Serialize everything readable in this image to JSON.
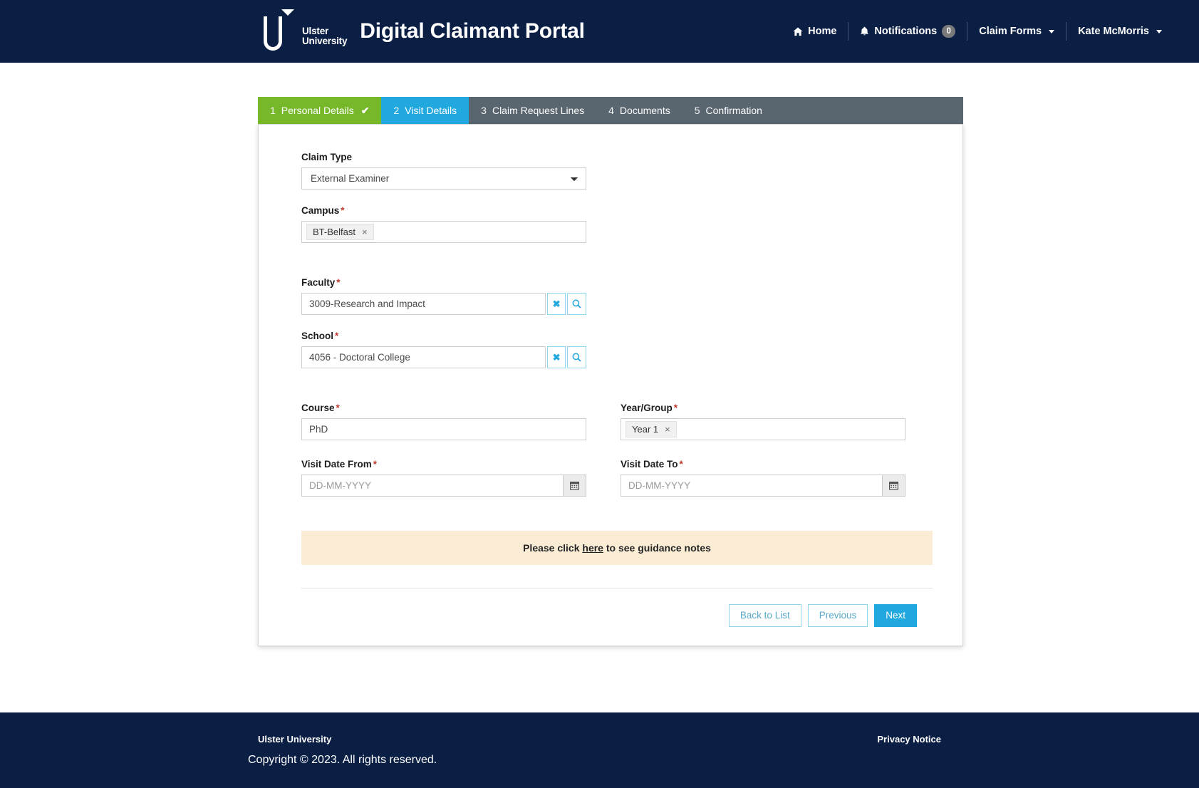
{
  "header": {
    "logo_line1": "Ulster",
    "logo_line2": "University",
    "title": "Digital Claimant Portal",
    "nav": {
      "home": "Home",
      "notifications": "Notifications",
      "notifications_count": "0",
      "claim_forms": "Claim Forms",
      "user": "Kate McMorris"
    }
  },
  "stepper": [
    {
      "num": "1",
      "label": "Personal Details",
      "state": "done",
      "check": "✔"
    },
    {
      "num": "2",
      "label": "Visit Details",
      "state": "active",
      "check": ""
    },
    {
      "num": "3",
      "label": "Claim Request Lines",
      "state": "",
      "check": ""
    },
    {
      "num": "4",
      "label": "Documents",
      "state": "",
      "check": ""
    },
    {
      "num": "5",
      "label": "Confirmation",
      "state": "",
      "check": ""
    }
  ],
  "form": {
    "claim_type": {
      "label": "Claim Type",
      "value": "External Examiner",
      "options": [
        "External Examiner"
      ]
    },
    "campus": {
      "label": "Campus",
      "required": "*",
      "chip": "BT-Belfast",
      "chip_remove": "×"
    },
    "faculty": {
      "label": "Faculty",
      "required": "*",
      "value": "3009-Research and Impact",
      "clear": "✖",
      "search": "🔍"
    },
    "school": {
      "label": "School",
      "required": "*",
      "value": "4056 - Doctoral College",
      "clear": "✖",
      "search": "🔍"
    },
    "course": {
      "label": "Course",
      "required": "*",
      "value": "PhD"
    },
    "year_group": {
      "label": "Year/Group",
      "required": "*",
      "chip": "Year 1",
      "chip_remove": "×"
    },
    "visit_date_from": {
      "label": "Visit Date From",
      "required": "*",
      "value": "",
      "placeholder": "DD-MM-YYYY"
    },
    "visit_date_to": {
      "label": "Visit Date To",
      "required": "*",
      "value": "",
      "placeholder": "DD-MM-YYYY"
    }
  },
  "notice": {
    "prefix": "Please click ",
    "link": "here",
    "suffix": " to see guidance notes"
  },
  "actions": {
    "back_to_list": "Back to List",
    "previous": "Previous",
    "next": "Next"
  },
  "footer": {
    "org": "Ulster University",
    "privacy": "Privacy Notice",
    "copyright": "Copyright © 2023. All rights reserved."
  },
  "colors": {
    "navy": "#0b1f45",
    "accent_blue": "#21a8de",
    "step_green": "#76b82a",
    "step_grey": "#596670",
    "notice_bg": "#fbedd5",
    "required_red": "#c0392b"
  }
}
